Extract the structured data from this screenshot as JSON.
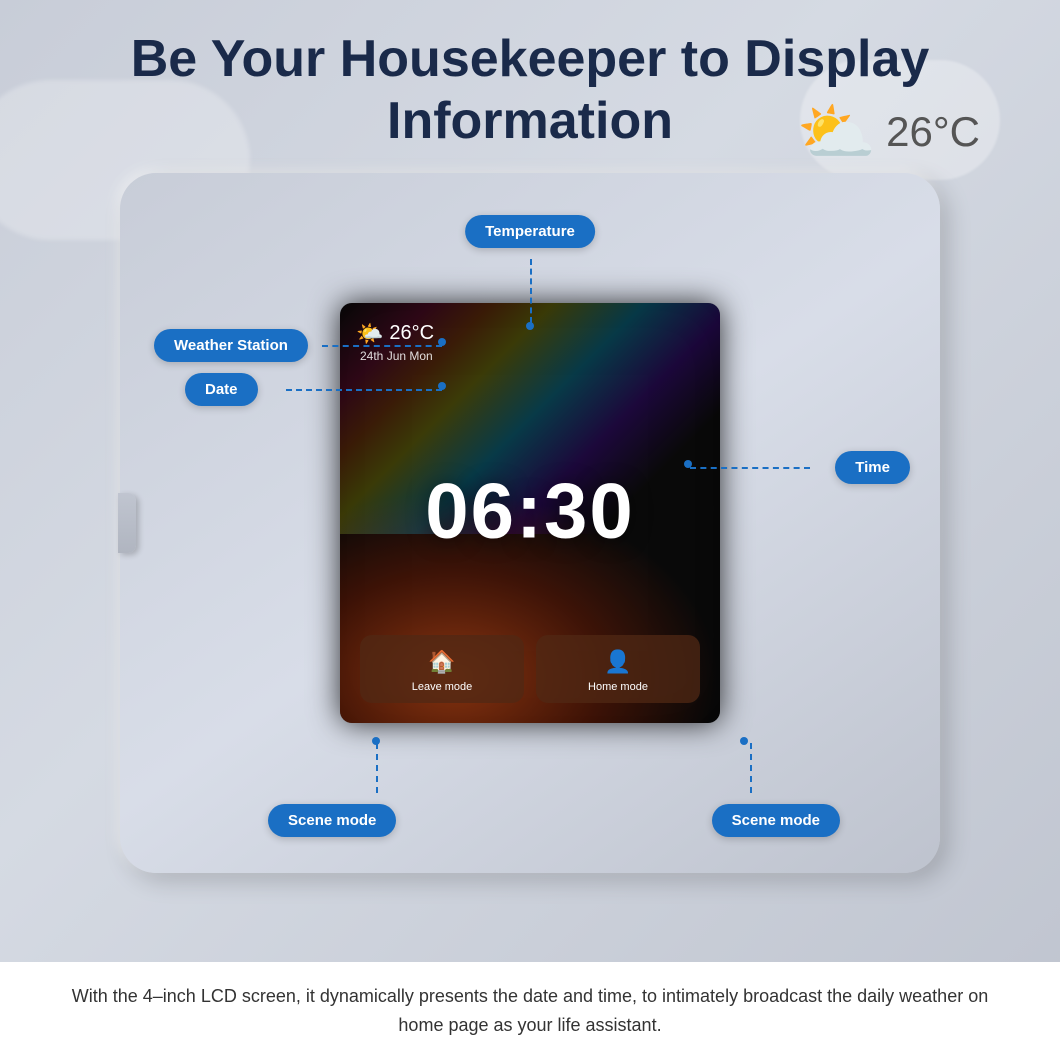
{
  "page": {
    "title_line1": "Be Your Housekeeper to Display",
    "title_line2": "Information",
    "bottom_description": "With the 4–inch LCD screen, it dynamically presents the date and time, to intimately broadcast the daily weather on home page as your life assistant."
  },
  "weather_header": {
    "icon": "⛅",
    "temperature": "26°C"
  },
  "screen": {
    "weather_icon": "🌤️",
    "temperature": "26°C",
    "date": "24th Jun  Mon",
    "time": "06:30",
    "leave_mode_label": "Leave mode",
    "home_mode_label": "Home mode"
  },
  "labels": {
    "temperature": "Temperature",
    "weather_station": "Weather Station",
    "date": "Date",
    "time": "Time",
    "scene_mode_left": "Scene mode",
    "scene_mode_right": "Scene mode"
  },
  "colors": {
    "label_bg": "#1a6fc4",
    "label_text": "#ffffff",
    "connector": "#1a6fc4"
  }
}
